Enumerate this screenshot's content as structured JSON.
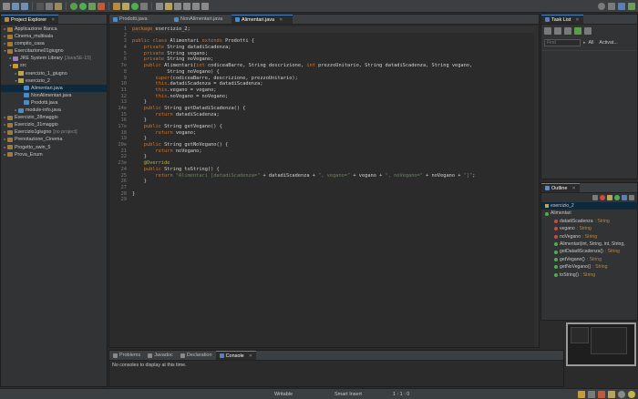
{
  "explorer": {
    "title": "Project Explorer",
    "items": [
      {
        "label": "Applicazione Banca",
        "depth": 0,
        "arrow": "▸",
        "icon": "project",
        "extra": ""
      },
      {
        "label": "Cinema_multisala",
        "depth": 0,
        "arrow": "▸",
        "icon": "project",
        "extra": ""
      },
      {
        "label": "compito_casa",
        "depth": 0,
        "arrow": "▸",
        "icon": "project",
        "extra": ""
      },
      {
        "label": "Esercitazione01giugno",
        "depth": 0,
        "arrow": "▾",
        "icon": "project",
        "extra": ""
      },
      {
        "label": "JRE System Library",
        "depth": 1,
        "arrow": "▸",
        "icon": "lib",
        "extra": "[JavaSE-15]"
      },
      {
        "label": "src",
        "depth": 1,
        "arrow": "▾",
        "icon": "folder",
        "extra": ""
      },
      {
        "label": "esercizio_1_giugno",
        "depth": 2,
        "arrow": "▸",
        "icon": "pkg",
        "extra": ""
      },
      {
        "label": "esercizio_2",
        "depth": 2,
        "arrow": "▾",
        "icon": "pkg",
        "extra": ""
      },
      {
        "label": "Alimentari.java",
        "depth": 3,
        "arrow": "",
        "icon": "java",
        "extra": "",
        "selected": true
      },
      {
        "label": "NonAlimentari.java",
        "depth": 3,
        "arrow": "",
        "icon": "java",
        "extra": ""
      },
      {
        "label": "Prodotti.java",
        "depth": 3,
        "arrow": "",
        "icon": "java",
        "extra": ""
      },
      {
        "label": "module-info.java",
        "depth": 2,
        "arrow": "▸",
        "icon": "java",
        "extra": ""
      },
      {
        "label": "Esercizio_28maggio",
        "depth": 0,
        "arrow": "▸",
        "icon": "project",
        "extra": ""
      },
      {
        "label": "Esercizio_31maggio",
        "depth": 0,
        "arrow": "▸",
        "icon": "project",
        "extra": ""
      },
      {
        "label": "Esercizio1giugno",
        "depth": 0,
        "arrow": "▸",
        "icon": "project",
        "extra": "[no project]"
      },
      {
        "label": "Prenotazione_Cinema",
        "depth": 0,
        "arrow": "▸",
        "icon": "project",
        "extra": ""
      },
      {
        "label": "Progetto_swin_5",
        "depth": 0,
        "arrow": "▸",
        "icon": "project",
        "extra": ""
      },
      {
        "label": "Prova_Enum",
        "depth": 0,
        "arrow": "▸",
        "icon": "project",
        "extra": ""
      }
    ]
  },
  "editor": {
    "tabs": [
      {
        "label": "Prodotti.java",
        "active": false
      },
      {
        "label": "NonAlimentari.java",
        "active": false
      },
      {
        "label": "Alimentari.java",
        "active": true
      }
    ],
    "lines": [
      {
        "n": "1",
        "code": "package esercizio_2;"
      },
      {
        "n": "2",
        "code": ""
      },
      {
        "n": "3",
        "code": "public class Alimentari extends Prodotti {"
      },
      {
        "n": "4",
        "code": "    private String datadiScadenza;"
      },
      {
        "n": "5",
        "code": "    private String vegano;"
      },
      {
        "n": "6",
        "code": "    private String noVegano;"
      },
      {
        "n": "7⊖",
        "code": "    public Alimentari(int codiceaBarre, String descrizione, int prezzoUnitario, String datadiScadenza, String vegano,"
      },
      {
        "n": "8",
        "code": "            String noVegano) {"
      },
      {
        "n": "9",
        "code": "        super(codiceaBarre, descrizione, prezzoUnitario);"
      },
      {
        "n": "10",
        "code": "        this.datadiScadenza = datadiScadenza;"
      },
      {
        "n": "11",
        "code": "        this.vegano = vegano;"
      },
      {
        "n": "12",
        "code": "        this.noVegano = noVegano;"
      },
      {
        "n": "13",
        "code": "    }"
      },
      {
        "n": "14⊖",
        "code": "    public String getDatadiScadenza() {"
      },
      {
        "n": "15",
        "code": "        return datadiScadenza;"
      },
      {
        "n": "16",
        "code": "    }"
      },
      {
        "n": "17⊖",
        "code": "    public String getVegano() {"
      },
      {
        "n": "18",
        "code": "        return vegano;"
      },
      {
        "n": "19",
        "code": "    }"
      },
      {
        "n": "20⊖",
        "code": "    public String getNoVegano() {"
      },
      {
        "n": "21",
        "code": "        return noVegano;"
      },
      {
        "n": "22",
        "code": "    }"
      },
      {
        "n": "23⊖",
        "code": "    @Override"
      },
      {
        "n": "24",
        "code": "    public String toString() {"
      },
      {
        "n": "25",
        "code": "        return \"Alimentari [datadiScadenza=\" + datadiScadenza + \", vegano=\" + vegano + \", noVegano=\" + noVegano + \"]\";"
      },
      {
        "n": "26",
        "code": "    }"
      },
      {
        "n": "27",
        "code": ""
      },
      {
        "n": "28",
        "code": "}"
      },
      {
        "n": "29",
        "code": ""
      }
    ]
  },
  "tasklist": {
    "title": "Task List",
    "find_placeholder": "Find",
    "all_label": "All",
    "activate_label": "Activat..."
  },
  "outline": {
    "title": "Outline",
    "items": [
      {
        "label": "esercizio_2",
        "type": "",
        "depth": 0,
        "icon": "package",
        "color": "#b9a55b",
        "selected": true
      },
      {
        "label": "Alimentari",
        "type": "",
        "depth": 0,
        "icon": "class",
        "color": "#4caf50"
      },
      {
        "label": "datadiScadenza",
        "type": ": String",
        "depth": 1,
        "icon": "private-field",
        "color": "#d04848"
      },
      {
        "label": "vegano",
        "type": ": String",
        "depth": 1,
        "icon": "private-field",
        "color": "#d04848"
      },
      {
        "label": "noVegano",
        "type": ": String",
        "depth": 1,
        "icon": "private-field",
        "color": "#d04848"
      },
      {
        "label": "Alimentari(int, String, int, String,",
        "type": "",
        "depth": 1,
        "icon": "constructor",
        "color": "#4caf50"
      },
      {
        "label": "getDatadiScadenza()",
        "type": ": String",
        "depth": 1,
        "icon": "method",
        "color": "#4caf50"
      },
      {
        "label": "getVegano()",
        "type": ": String",
        "depth": 1,
        "icon": "method",
        "color": "#4caf50"
      },
      {
        "label": "getNoVegano()",
        "type": ": String",
        "depth": 1,
        "icon": "method",
        "color": "#4caf50"
      },
      {
        "label": "toString()",
        "type": ": String",
        "depth": 1,
        "icon": "override-method",
        "color": "#4caf50"
      }
    ]
  },
  "bottom": {
    "tabs": [
      {
        "label": "Problems",
        "active": false
      },
      {
        "label": "Javadoc",
        "active": false
      },
      {
        "label": "Declaration",
        "active": false
      },
      {
        "label": "Console",
        "active": true
      }
    ],
    "message": "No consoles to display at this time."
  },
  "status": {
    "writable": "Writable",
    "insert_mode": "Smart Insert",
    "position": "1 : 1 : 0"
  },
  "colors": {
    "accent": "#4a88c7",
    "background": "#2b2b2b",
    "keyword": "#cc7832",
    "string": "#6a8759",
    "field": "#9876aa"
  }
}
